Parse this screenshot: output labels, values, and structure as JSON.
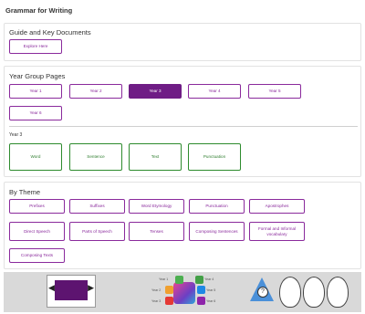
{
  "page_title": "Grammar for Writing",
  "guide": {
    "heading": "Guide and Key Documents",
    "explore_label": "Explore Here"
  },
  "year_groups": {
    "heading": "Year Group Pages",
    "years": [
      "Year 1",
      "Year 2",
      "Year 3",
      "Year 4",
      "Year 5",
      "Year 6"
    ],
    "selected": "Year 3",
    "selected_label": "Year 3",
    "sub_buttons": [
      "Word",
      "Sentence",
      "Text",
      "Punctuation"
    ]
  },
  "by_theme": {
    "heading": "By Theme",
    "items": [
      "Prefixes",
      "Suffixes",
      "Word Etymology",
      "Punctuation",
      "Apostrophes",
      "Direct Speech",
      "Parts of Speech",
      "Tenses",
      "Composing Sentences",
      "Formal and Informal vocabulary",
      "Composing Texts"
    ]
  },
  "footer": {
    "year_labels": [
      "Year 1",
      "Year 2",
      "Year 3",
      "Year 4",
      "Year 5",
      "Year 6"
    ],
    "colors": {
      "accent": "#8a2a9c",
      "active": "#6f1d85",
      "green": "#2e8b2e"
    }
  }
}
